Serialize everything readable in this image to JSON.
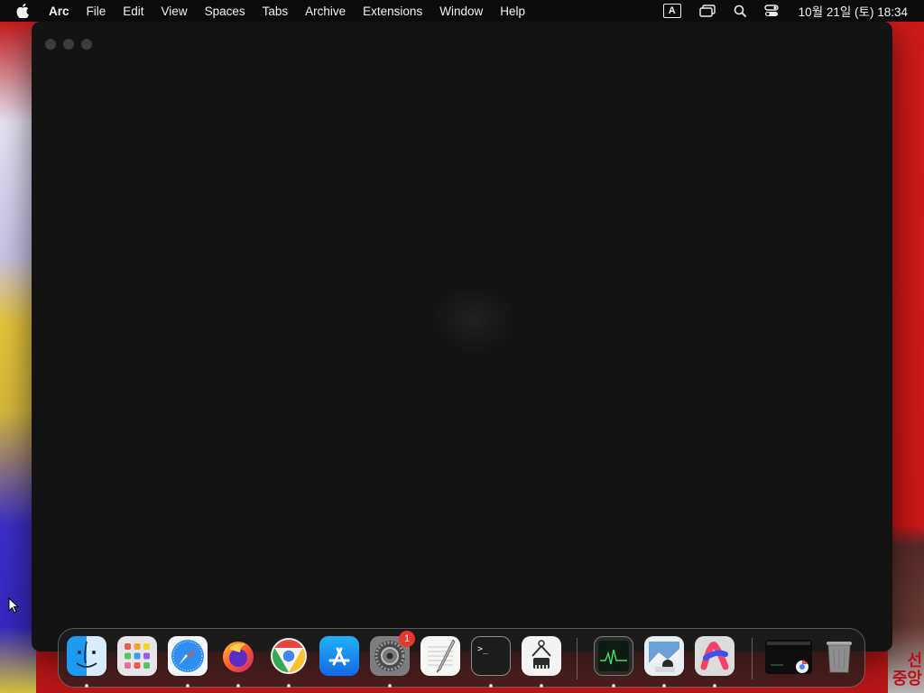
{
  "menubar": {
    "app_name": "Arc",
    "items": [
      "File",
      "Edit",
      "View",
      "Spaces",
      "Tabs",
      "Archive",
      "Extensions",
      "Window",
      "Help"
    ],
    "input_source": "A",
    "clock": "10월 21일 (토) 18:34"
  },
  "window": {
    "app": "Arc"
  },
  "dock": {
    "apps": [
      {
        "name": "Finder",
        "icon": "finder-icon",
        "running": true
      },
      {
        "name": "Launchpad",
        "icon": "launchpad-icon",
        "running": false
      },
      {
        "name": "Safari",
        "icon": "safari-icon",
        "running": true
      },
      {
        "name": "Firefox",
        "icon": "firefox-icon",
        "running": true
      },
      {
        "name": "Google Chrome",
        "icon": "chrome-icon",
        "running": true
      },
      {
        "name": "App Store",
        "icon": "app-store-icon",
        "running": false
      },
      {
        "name": "System Settings",
        "icon": "system-settings-icon",
        "running": true,
        "badge": "1"
      },
      {
        "name": "TextEdit",
        "icon": "textedit-icon",
        "running": false
      },
      {
        "name": "Terminal",
        "icon": "terminal-icon",
        "running": true
      },
      {
        "name": "System Information",
        "icon": "system-information-icon",
        "running": true
      },
      {
        "name": "Activity Monitor",
        "icon": "activity-monitor-icon",
        "running": true
      },
      {
        "name": "Preview",
        "icon": "preview-icon",
        "running": true
      },
      {
        "name": "Arc",
        "icon": "arc-icon",
        "running": true
      }
    ],
    "recent": [
      {
        "name": "Chrome window",
        "icon": "chrome-window-thumbnail"
      }
    ],
    "trash": {
      "name": "Trash",
      "icon": "trash-icon"
    }
  },
  "wallpaper": {
    "sign_text": "선\n중앙"
  }
}
